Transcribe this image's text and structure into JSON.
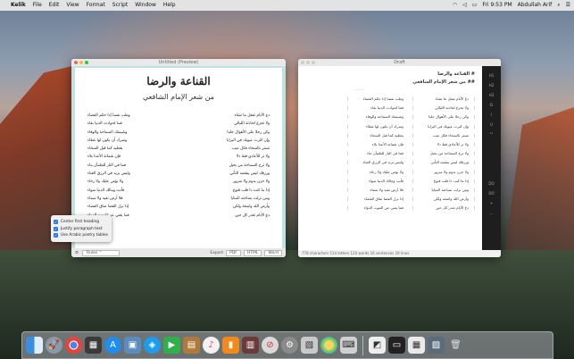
{
  "menubar": {
    "app": "Kelik",
    "items": [
      "File",
      "Edit",
      "View",
      "Format",
      "Script",
      "Window",
      "Help"
    ],
    "clock": "Fri 9:53 PM",
    "user": "Abdullah Arif"
  },
  "preview": {
    "window_title": "Untitled (Preview)",
    "title": "القناعة والرضا",
    "subtitle": "من شعر الإمام الشافعي",
    "poem": [
      [
        "دع الأيام تفعل ما تشاء",
        "وطب نفسا إذا حكم القضاء"
      ],
      [
        "ولا تجزع لحادثة الليالي",
        "فما لحوادث الدنيا بقاء"
      ],
      [
        "وكن رجلا على الأهوال جلدا",
        "وشيمتك السماحة والوفاء"
      ],
      [
        "وإن كثرت عيوبك في البرايا",
        "وسرك أن يكون لها غطاء"
      ],
      [
        "تستر بالسخاء فكل عيب",
        "يغطيه كما قيل السخاء"
      ],
      [
        "ولا تر للأعادي قط ذلا",
        "فإن شماتة الأعدا بلاء"
      ],
      [
        "ولا ترج السماحة من بخيل",
        "فما في النار للظمآن ماء"
      ],
      [
        "ورزقك ليس ينقصه التأني",
        "وليس يزيد في الرزق العناء"
      ],
      [
        "ولا حزن يدوم ولا سرور",
        "ولا بؤس عليك ولا رخاء"
      ],
      [
        "إذا ما كنت ذا قلب قنوع",
        "فأنت ومالك الدنيا سواء"
      ],
      [
        "ومن نزلت بساحته المنايا",
        "فلا أرض تقيه ولا سماء"
      ],
      [
        "وأرض الله واسعة ولكن",
        "إذا نزل القضا ضاق الفضاء"
      ],
      [
        "دع الأيام تغدر كل حين",
        "فما يغني عن الموت الدواء"
      ]
    ],
    "style_label": "Rules",
    "export_label": "Export",
    "export_options": [
      "PDF",
      "HTML",
      "Word"
    ]
  },
  "popover": {
    "options": [
      "Center first heading",
      "Justify paragraph text",
      "Use Arabic poetry tables"
    ]
  },
  "editor": {
    "window_title": "Draft",
    "h1": "# القناعة والرضا",
    "h2": "## من شعر الإمام الشافعي",
    "sep": "- - - - -",
    "sidebar": [
      "H1",
      "H2",
      "H3",
      "B",
      "I",
      "U",
      "\"\"",
      "DO",
      "DO",
      "+",
      "..."
    ],
    "status": "778 characters    514 letters    120 words    16 sentences    16 lines"
  },
  "dock": [
    "finder",
    "launchpad",
    "chrome",
    "photo-booth",
    "app-store",
    "preview",
    "safari",
    "facetime",
    "notes",
    "itunes",
    "ibooks",
    "photo-strip",
    "no-entry",
    "system-preferences",
    "image-capture",
    "photos",
    "typewriter",
    "screenshot",
    "terminal",
    "preview-2",
    "desktop",
    "trash"
  ]
}
